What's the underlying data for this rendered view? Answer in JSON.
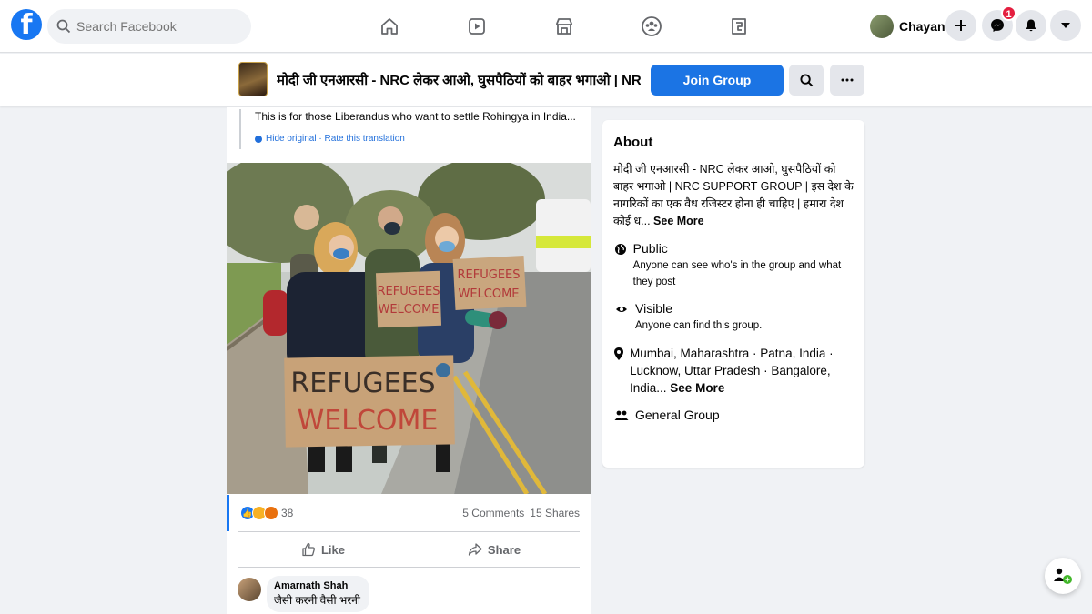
{
  "topnav": {
    "logo": "f",
    "search_placeholder": "Search Facebook",
    "profile_name": "Chayan",
    "messenger_badge": "1"
  },
  "group": {
    "title": "मोदी जी एनआरसी - NRC लेकर आओ, घुसपैठियों को बाहर भगाओ | NR...",
    "join_label": "Join Group"
  },
  "post": {
    "caption": "This is for those Liberandus who want to settle Rohingya in India...",
    "hide_original": "Hide original",
    "rate_translation": "Rate this translation",
    "sign_small_1": "REFUGEES",
    "sign_small_2": "WELCOME",
    "sign_big_1": "REFUGEES",
    "sign_big_2": "WELCOME",
    "reaction_count": "38",
    "comments": "5 Comments",
    "shares": "15 Shares",
    "like_label": "Like",
    "share_label": "Share",
    "comment_author": "Amarnath Shah",
    "comment_text": "जैसी करनी वैसी भरनी"
  },
  "about": {
    "title": "About",
    "description": "मोदी जी एनआरसी - NRC लेकर आओ, घुसपैठियों को बाहर भगाओ | NRC SUPPORT GROUP | इस देश के नागरिकों का एक वैध रजिस्टर होना ही चाहिए | हमारा देश कोई ध...",
    "see_more": "See More",
    "public_title": "Public",
    "public_desc": "Anyone can see who's in the group and what they post",
    "visible_title": "Visible",
    "visible_desc": "Anyone can find this group.",
    "location": "Mumbai, Maharashtra · Patna, India · Lucknow, Uttar Pradesh · Bangalore, India...",
    "location_more": "See More",
    "type": "General Group"
  },
  "colors": {
    "brand": "#1877f2",
    "join_button": "#1b74e4",
    "badge": "#e41e3f"
  }
}
